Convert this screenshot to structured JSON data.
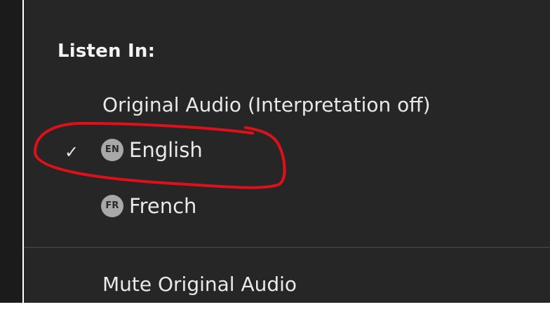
{
  "menu": {
    "section_title": "Listen In:",
    "items": [
      {
        "label": "Original Audio (Interpretation off)",
        "selected": false
      },
      {
        "badge": "EN",
        "label": "English",
        "selected": true,
        "check": "✓"
      },
      {
        "badge": "FR",
        "label": "French",
        "selected": false
      }
    ],
    "mute_label": "Mute Original Audio"
  },
  "annotation": {
    "type": "hand-drawn-ellipse",
    "color": "#e0101a",
    "target": "English"
  },
  "colors": {
    "menu_background": "#262626",
    "text": "#e9e9e9",
    "badge": "#a8a8a8",
    "separator": "#3b3b3b"
  }
}
